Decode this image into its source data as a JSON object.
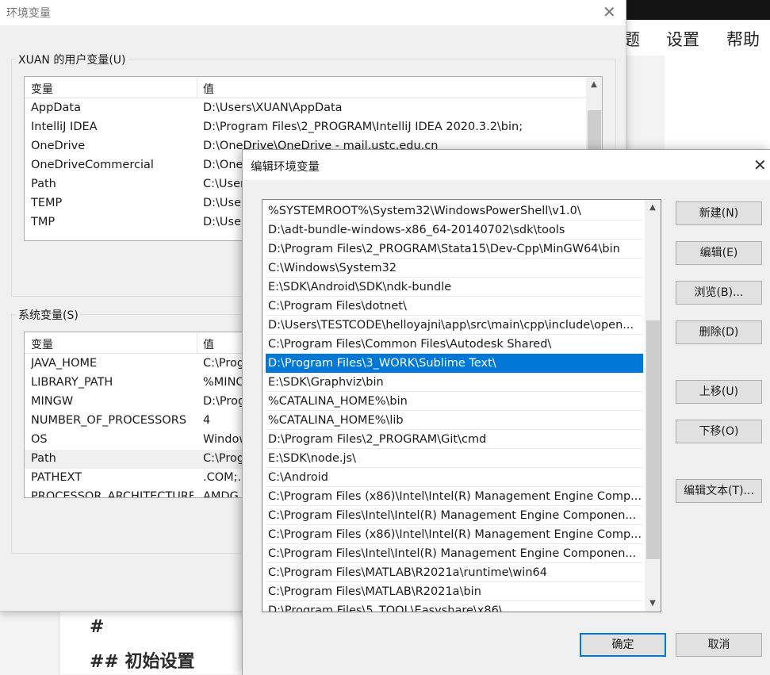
{
  "background_app": {
    "menu": [
      "题",
      "设置",
      "帮助"
    ],
    "doc_lines": [
      "#",
      "##  初始设置"
    ]
  },
  "env_window": {
    "title": "环境变量",
    "user_vars": {
      "label": "XUAN 的用户变量(U)",
      "headers": [
        "变量",
        "值"
      ],
      "rows": [
        {
          "name": "AppData",
          "value": "D:\\Users\\XUAN\\AppData"
        },
        {
          "name": "IntelliJ IDEA",
          "value": "D:\\Program Files\\2_PROGRAM\\IntelliJ IDEA 2020.3.2\\bin;"
        },
        {
          "name": "OneDrive",
          "value": "D:\\OneDrive\\OneDrive - mail.ustc.edu.cn"
        },
        {
          "name": "OneDriveCommercial",
          "value": "D:\\One"
        },
        {
          "name": "Path",
          "value": "C:\\User"
        },
        {
          "name": "TEMP",
          "value": "D:\\User"
        },
        {
          "name": "TMP",
          "value": "D:\\User"
        }
      ]
    },
    "system_vars": {
      "label": "系统变量(S)",
      "headers": [
        "变量",
        "值"
      ],
      "rows": [
        {
          "name": "JAVA_HOME",
          "value": "C:\\Prog"
        },
        {
          "name": "LIBRARY_PATH",
          "value": "%MINC"
        },
        {
          "name": "MINGW",
          "value": "D:\\Prog"
        },
        {
          "name": "NUMBER_OF_PROCESSORS",
          "value": "4"
        },
        {
          "name": "OS",
          "value": "Window"
        },
        {
          "name": "Path",
          "value": "C:\\Prog"
        },
        {
          "name": "PATHEXT",
          "value": ".COM;."
        },
        {
          "name": "PROCESSOR_ARCHITECTURE",
          "value": "AMDG"
        }
      ],
      "highlighted_row": "Path"
    }
  },
  "edit_dialog": {
    "title": "编辑环境变量",
    "paths": [
      "%SYSTEMROOT%\\System32\\WindowsPowerShell\\v1.0\\",
      "D:\\adt-bundle-windows-x86_64-20140702\\sdk\\tools",
      "D:\\Program Files\\2_PROGRAM\\Stata15\\Dev-Cpp\\MinGW64\\bin",
      "C:\\Windows\\System32",
      "E:\\SDK\\Android\\SDK\\ndk-bundle",
      "C:\\Program Files\\dotnet\\",
      "D:\\Users\\TESTCODE\\helloyajni\\app\\src\\main\\cpp\\include\\open...",
      "C:\\Program Files\\Common Files\\Autodesk Shared\\",
      "D:\\Program Files\\3_WORK\\Sublime Text\\",
      "E:\\SDK\\Graphviz\\bin",
      "%CATALINA_HOME%\\bin",
      "%CATALINA_HOME%\\lib",
      "D:\\Program Files\\2_PROGRAM\\Git\\cmd",
      "E:\\SDK\\node.js\\",
      "C:\\Android",
      "C:\\Program Files (x86)\\Intel\\Intel(R) Management Engine Comp...",
      "C:\\Program Files\\Intel\\Intel(R) Management Engine Componen...",
      "C:\\Program Files (x86)\\Intel\\Intel(R) Management Engine Comp...",
      "C:\\Program Files\\Intel\\Intel(R) Management Engine Componen...",
      "C:\\Program Files\\MATLAB\\R2021a\\runtime\\win64",
      "C:\\Program Files\\MATLAB\\R2021a\\bin",
      "D:\\Program Files\\5_TOOL\\Easyshare\\x86\\"
    ],
    "selected_path": "D:\\Program Files\\3_WORK\\Sublime Text\\",
    "buttons": {
      "new": "新建(N)",
      "edit": "编辑(E)",
      "browse": "浏览(B)...",
      "delete": "删除(D)",
      "move_up": "上移(U)",
      "move_down": "下移(O)",
      "edit_text": "编辑文本(T)...",
      "ok": "确定",
      "cancel": "取消"
    }
  }
}
